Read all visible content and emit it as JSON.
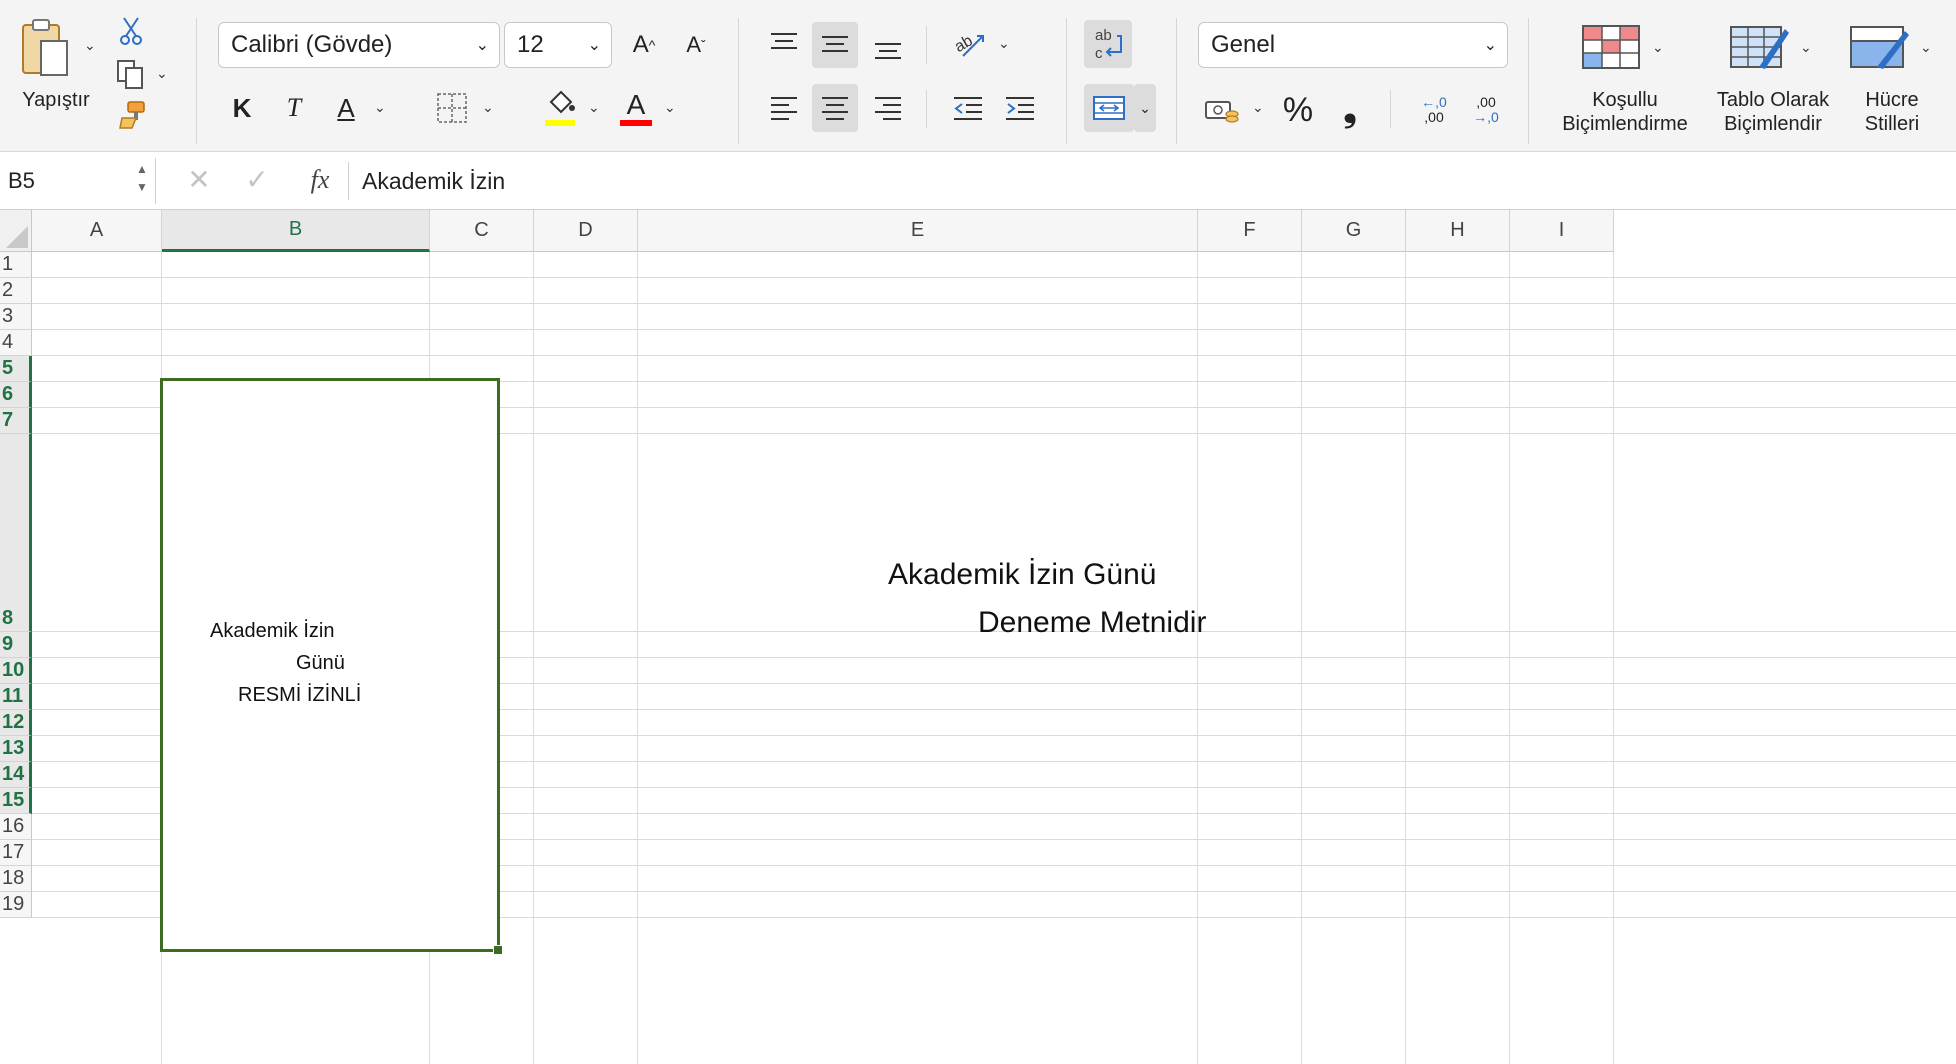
{
  "ribbon": {
    "paste_label": "Yapıştır",
    "font_name": "Calibri (Gövde)",
    "font_size": "12",
    "bold_label": "K",
    "italic_label": "T",
    "underline_label": "A",
    "font_color_label": "A",
    "grow_font_label": "A",
    "shrink_font_label": "A",
    "number_format": "Genel",
    "percent_label": "%",
    "comma_label": "❟",
    "increase_decimal_top": "←,0",
    "increase_decimal_bottom": ",00",
    "decrease_decimal_top": ",00",
    "decrease_decimal_bottom": "→,0",
    "wrap_text_label": "ab c",
    "conditional_formatting_label": [
      "Koşullu",
      "Biçimlendirme"
    ],
    "format_as_table_label": [
      "Tablo Olarak",
      "Biçimlendir"
    ],
    "cell_styles_label": [
      "Hücre",
      "Stilleri"
    ],
    "colors": {
      "fill_color_bar": "#ffff00",
      "font_color_bar": "#ff0000",
      "accent_green": "#217346"
    }
  },
  "formula_bar": {
    "name_box": "B5",
    "fx_label": "fx",
    "content": "Akademik İzin"
  },
  "columns": [
    "A",
    "B",
    "C",
    "D",
    "E",
    "F",
    "G",
    "H",
    "I"
  ],
  "selected_column": "B",
  "rows": [
    "1",
    "2",
    "3",
    "4",
    "5",
    "6",
    "7",
    "8",
    "9",
    "10",
    "11",
    "12",
    "13",
    "14",
    "15",
    "16",
    "17",
    "18",
    "19"
  ],
  "selected_rows": [
    "5",
    "6",
    "7",
    "8",
    "9",
    "10",
    "11",
    "12",
    "13",
    "14",
    "15"
  ],
  "cells": {
    "B5": {
      "line1": "Akademik İzin",
      "line2": "Günü",
      "line3": "RESMİ İZİNLİ"
    },
    "E8": {
      "line1": "Akademik İzin Günü",
      "line2": "Deneme Metnidir"
    }
  }
}
